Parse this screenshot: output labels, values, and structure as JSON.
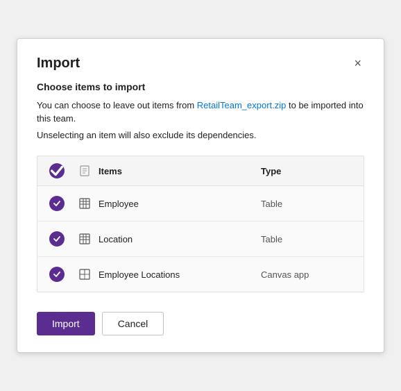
{
  "dialog": {
    "title": "Import",
    "close_label": "×",
    "subtitle1": "Choose items to import",
    "subtitle2": "You can choose to leave out items from RetailTeam_export.zip to be imported into this team.",
    "subtitle3": "Unselecting an item will also exclude its dependencies.",
    "table": {
      "columns": [
        {
          "key": "check",
          "label": ""
        },
        {
          "key": "icon",
          "label": ""
        },
        {
          "key": "items",
          "label": "Items"
        },
        {
          "key": "type",
          "label": "Type"
        }
      ],
      "rows": [
        {
          "name": "Employee",
          "type": "Table",
          "checked": true,
          "icon": "table"
        },
        {
          "name": "Location",
          "type": "Table",
          "checked": true,
          "icon": "table"
        },
        {
          "name": "Employee Locations",
          "type": "Canvas app",
          "checked": true,
          "icon": "canvas"
        }
      ]
    },
    "footer": {
      "import_label": "Import",
      "cancel_label": "Cancel"
    }
  }
}
